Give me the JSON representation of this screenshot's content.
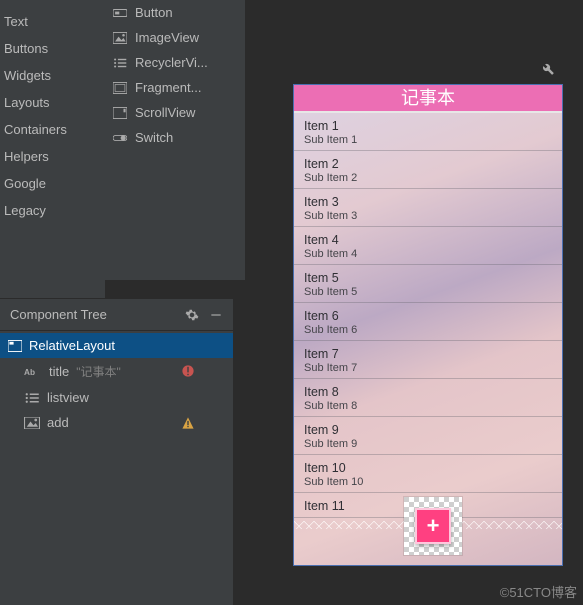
{
  "palette_categories": [
    "Text",
    "Buttons",
    "Widgets",
    "Layouts",
    "Containers",
    "Helpers",
    "Google",
    "Legacy"
  ],
  "palette_items": [
    {
      "label": "Button",
      "icon": "button-icon"
    },
    {
      "label": "ImageView",
      "icon": "image-icon"
    },
    {
      "label": "RecyclerVi...",
      "icon": "list-icon"
    },
    {
      "label": "Fragment...",
      "icon": "fragment-icon"
    },
    {
      "label": "ScrollView",
      "icon": "scroll-icon"
    },
    {
      "label": "Switch",
      "icon": "switch-icon"
    }
  ],
  "tree": {
    "header": "Component Tree",
    "root": "RelativeLayout",
    "children": [
      {
        "id": "title",
        "extra": "\"记事本\"",
        "badge": "error",
        "icon": "text-ab-icon"
      },
      {
        "id": "listview",
        "badge": "",
        "icon": "list-icon"
      },
      {
        "id": "add",
        "badge": "warning",
        "icon": "image-icon"
      }
    ]
  },
  "preview": {
    "title": "记事本",
    "items": [
      {
        "t": "Item 1",
        "s": "Sub Item 1"
      },
      {
        "t": "Item 2",
        "s": "Sub Item 2"
      },
      {
        "t": "Item 3",
        "s": "Sub Item 3"
      },
      {
        "t": "Item 4",
        "s": "Sub Item 4"
      },
      {
        "t": "Item 5",
        "s": "Sub Item 5"
      },
      {
        "t": "Item 6",
        "s": "Sub Item 6"
      },
      {
        "t": "Item 7",
        "s": "Sub Item 7"
      },
      {
        "t": "Item 8",
        "s": "Sub Item 8"
      },
      {
        "t": "Item 9",
        "s": "Sub Item 9"
      },
      {
        "t": "Item 10",
        "s": "Sub Item 10"
      },
      {
        "t": "Item 11",
        "s": ""
      }
    ]
  },
  "watermark": "©51CTO博客"
}
